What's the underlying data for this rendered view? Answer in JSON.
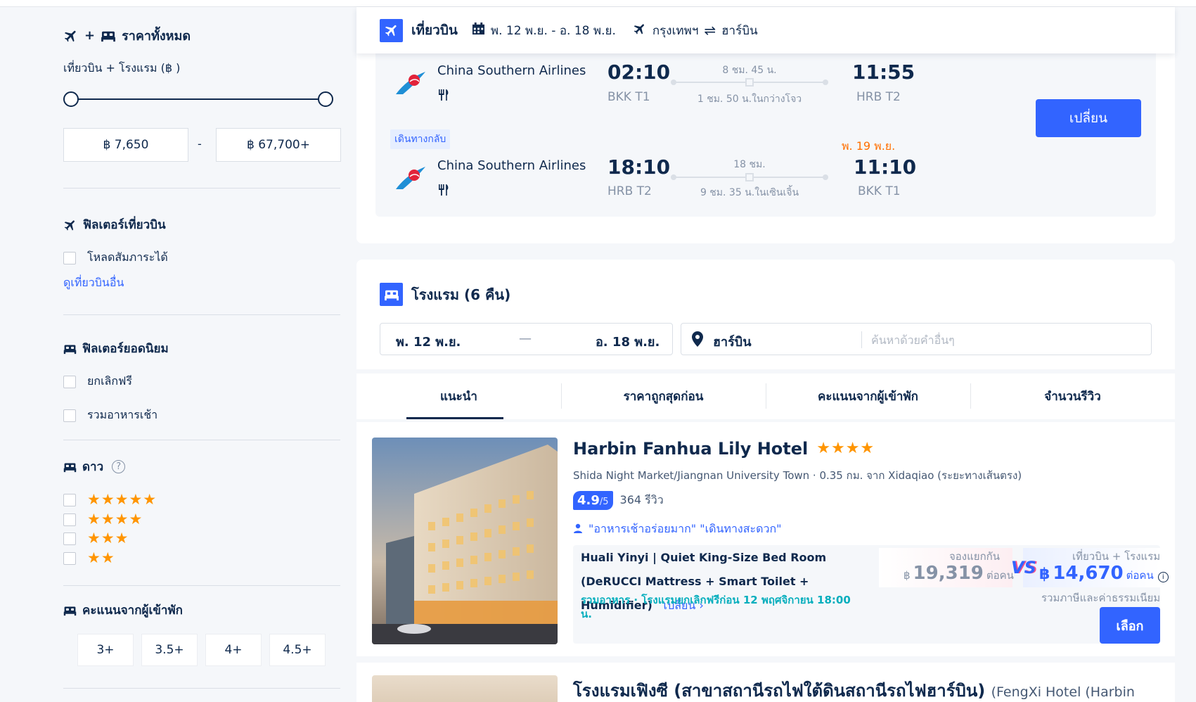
{
  "sidebar": {
    "all_prices_title": "ราคาทั้งหมด",
    "price_label": "เที่ยวบิน + โรงแรม (฿ )",
    "price_min": "฿ 7,650",
    "price_max": "฿ 67,700+",
    "price_dash": "-",
    "flight_filter_title": "ฟิลเตอร์เที่ยวบิน",
    "baggage_label": "โหลดสัมภาระได้",
    "other_flights_link": "ดูเที่ยวบินอื่น",
    "popular_filter_title": "ฟิลเตอร์ยอดนิยม",
    "free_cancel_label": "ยกเลิกฟรี",
    "breakfast_label": "รวมอาหารเช้า",
    "stars_title": "ดาว",
    "help_glyph": "?",
    "star_options": [
      "★★★★★",
      "★★★★",
      "★★★",
      "★★"
    ],
    "guest_score_title": "คะแนนจากผู้เข้าพัก",
    "score_options": [
      "3+",
      "3.5+",
      "4+",
      "4.5+"
    ]
  },
  "flight": {
    "title": "เที่ยวบิน",
    "dates": "พ. 12 พ.ย. - อ. 18 พ.ย.",
    "origin": "กรุงเทพฯ",
    "destination": "ฮาร์บิน",
    "outbound": {
      "airline": "China Southern Airlines",
      "depart_time": "02:10",
      "depart_airport": "BKK T1",
      "duration": "8 ชม. 45 น.",
      "layover": "1 ชม. 50 น.ในกว่างโจว",
      "arrive_time": "11:55",
      "arrive_airport": "HRB T2"
    },
    "return_tag": "เดินทางกลับ",
    "return": {
      "airline": "China Southern Airlines",
      "depart_time": "18:10",
      "depart_airport": "HRB T2",
      "duration": "18 ชม.",
      "layover": "9 ชม. 35 น.ในเซินเจิ้น",
      "arrive_date": "พ. 19 พ.ย.",
      "arrive_time": "11:10",
      "arrive_airport": "BKK T1"
    },
    "change_button": "เปลี่ยน"
  },
  "hotel": {
    "title": "โรงแรม (6 คืน)",
    "checkin": "พ. 12 พ.ย.",
    "checkout": "อ. 18 พ.ย.",
    "date_sep": "—",
    "city": "ฮาร์บิน",
    "search_placeholder": "ค้นหาด้วยคำอื่นๆ",
    "tabs": [
      "แนะนำ",
      "ราคาถูกสุดก่อน",
      "คะแนนจากผู้เข้าพัก",
      "จำนวนรีวิว"
    ]
  },
  "result1": {
    "name": "Harbin Fanhua Lily Hotel",
    "stars": "★★★★",
    "location": "Shida Night Market/Jiangnan University Town · 0.35 กม. จาก Xidaqiao (ระยะทางเส้นตรง)",
    "score": "4.9",
    "score_max": "/5",
    "reviews": "364 รีวิว",
    "quotes": "\"อาหารเช้าอร่อยมาก\"  \"เดินทางสะดวก\"",
    "room": "Huali Yinyi | Quiet King-Size Bed Room (DeRUCCI Mattress + Smart Toilet + Humidifier)",
    "room_change": "เปลี่ยน",
    "perks": "รวมอาหาร · โรงแรมยกเลิกฟรีก่อน 12 พฤศจิกายน 18:00 น.",
    "separate_label": "จองแยกกัน",
    "separate_currency": "฿",
    "separate_price": "19,319",
    "per_person": "ต่อคน",
    "vs": "VS",
    "bundle_label": "เที่ยวบิน + โรงแรม",
    "bundle_currency": "฿",
    "bundle_price": "14,670",
    "info_glyph": "i",
    "tax_note": "รวมภาษีและค่าธรรมเนียม",
    "select_button": "เลือก"
  },
  "result2": {
    "name": "โรงแรมเฟิงซี (สาขาสถานีรถไฟใต้ดินสถานีรถไฟฮาร์บิน)",
    "name_en": "(FengXi Hotel (Harbin"
  },
  "colors": {
    "accent": "#3264ff",
    "navy": "#0f294d",
    "star": "#ff9500",
    "perk_teal": "#06aebd",
    "next_day": "#ff6f00"
  }
}
